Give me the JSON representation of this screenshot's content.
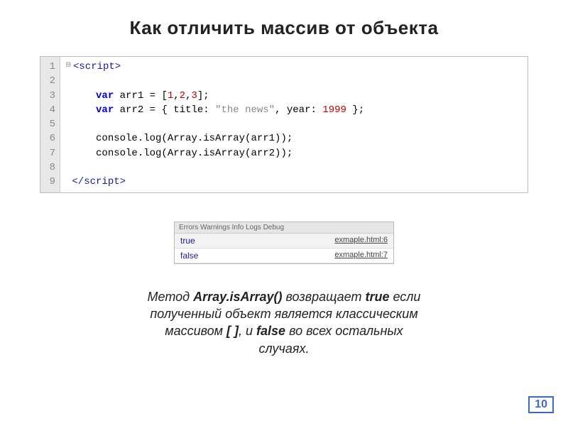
{
  "title": "Как отличить массив от объекта",
  "code": {
    "lines": [
      "1",
      "2",
      "3",
      "4",
      "5",
      "6",
      "7",
      "8",
      "9"
    ],
    "openTag": "<script>",
    "closeTag": "</script>",
    "varKw": "var",
    "arr1_name": " arr1 = [",
    "n1": "1",
    "c1": ",",
    "n2": "2",
    "c2": ",",
    "n3": "3",
    "arr1_end": "];",
    "arr2_name": " arr2 = { title: ",
    "str1": "\"the news\"",
    "arr2_mid": ", year: ",
    "n1999": "1999",
    "arr2_end": " };",
    "log1": "console.log(Array.isArray(arr1));",
    "log2": "console.log(Array.isArray(arr2));"
  },
  "console": {
    "header": "Errors   Warnings   Info   Logs   Debug",
    "rows": [
      {
        "value": "true",
        "source": "exmaple.html:6"
      },
      {
        "value": "false",
        "source": "exmaple.html:7"
      }
    ]
  },
  "explain": {
    "p1a": "Метод ",
    "p1b": "Array.isArray()",
    "p1c": " возвращает ",
    "p1d": "true",
    "p1e": " если",
    "p2": "полученный объект является классическим",
    "p3a": "массивом ",
    "p3b": "[ ]",
    "p3c": ", и ",
    "p3d": "false",
    "p3e": " во всех остальных",
    "p4": "случаях."
  },
  "pageNumber": "10"
}
